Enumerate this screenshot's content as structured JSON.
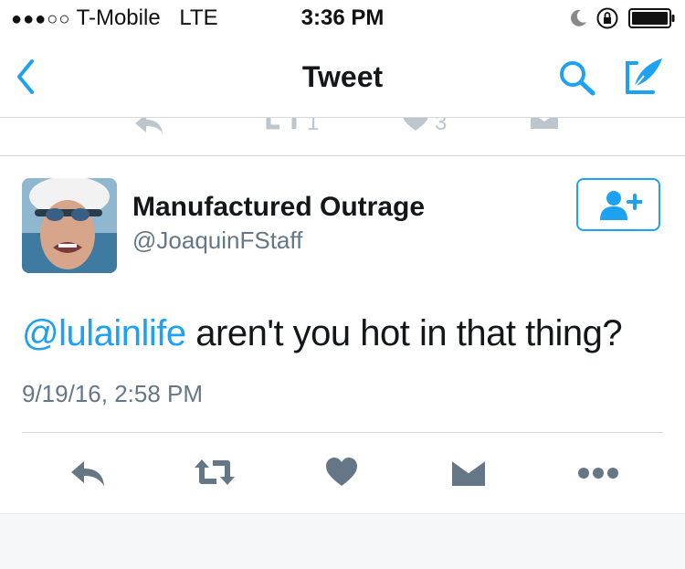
{
  "status_bar": {
    "signal": "●●●○○",
    "carrier": "T-Mobile",
    "network": "LTE",
    "time": "3:36 PM"
  },
  "nav": {
    "title": "Tweet"
  },
  "previous_tweet_actions": {
    "retweet_count": "1",
    "like_count": "3"
  },
  "tweet": {
    "author_name": "Manufactured Outrage",
    "author_handle": "@JoaquinFStaff",
    "mention": "@lulainlife",
    "text": " aren't you hot in that thing?",
    "timestamp": "9/19/16, 2:58 PM"
  },
  "colors": {
    "accent": "#1da1f2",
    "action_gray": "#657786",
    "faded_gray": "#8899a6"
  }
}
